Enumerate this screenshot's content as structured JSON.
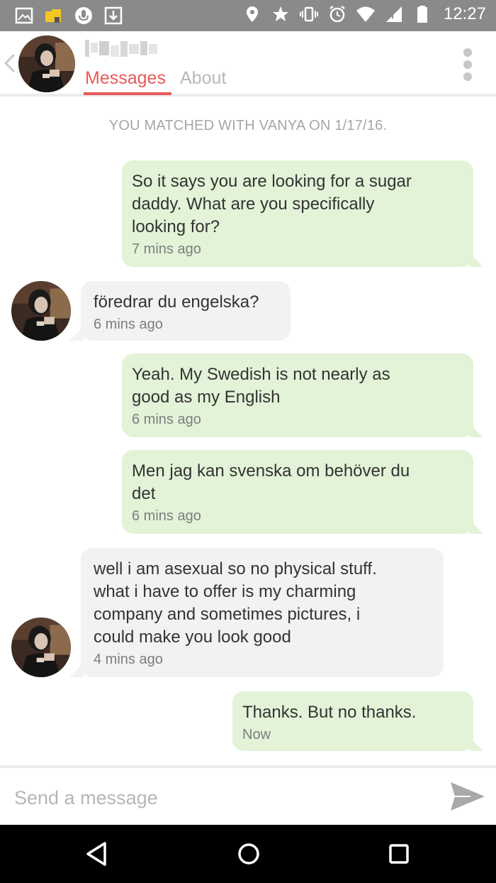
{
  "status_bar": {
    "time": "12:27",
    "left_icons": [
      "image-icon",
      "folder-icon",
      "microphone-icon",
      "download-icon"
    ],
    "right_icons": [
      "location-icon",
      "star-icon",
      "vibrate-icon",
      "alarm-icon",
      "wifi-icon",
      "signal-icon",
      "battery-icon"
    ]
  },
  "header": {
    "contact_name_blurred": true,
    "tabs": [
      {
        "label": "Messages",
        "active": true
      },
      {
        "label": "About",
        "active": false
      }
    ],
    "accent_color": "#e85a5a"
  },
  "chat": {
    "match_notice": "YOU MATCHED WITH VANYA ON 1/17/16.",
    "messages": [
      {
        "direction": "outgoing",
        "lines": [
          "So it says you are looking for a sugar",
          "daddy.  What are you specifically",
          "looking for?"
        ],
        "time": "7 mins ago"
      },
      {
        "direction": "incoming",
        "lines": [
          "föredrar du engelska?"
        ],
        "time": "6 mins ago"
      },
      {
        "direction": "outgoing",
        "lines": [
          "Yeah.  My Swedish is not nearly as",
          "good as my English"
        ],
        "time": "6 mins ago"
      },
      {
        "direction": "outgoing",
        "lines": [
          "Men jag kan svenska om behöver du",
          "det"
        ],
        "time": "6 mins ago"
      },
      {
        "direction": "incoming",
        "lines": [
          "well i am asexual so no physical stuff.",
          "what i have to offer is my charming",
          "company and sometimes pictures, i",
          "could make you look good"
        ],
        "time": "4 mins ago"
      },
      {
        "direction": "outgoing",
        "lines": [
          "Thanks.  But no thanks."
        ],
        "time": "Now"
      }
    ],
    "outgoing_color": "#e2f3d7",
    "incoming_color": "#f2f2f2"
  },
  "composer": {
    "placeholder": "Send a message",
    "value": "",
    "send_icon": "send-icon"
  },
  "nav_bar": {
    "buttons": [
      "back-icon",
      "home-icon",
      "recents-icon"
    ]
  }
}
